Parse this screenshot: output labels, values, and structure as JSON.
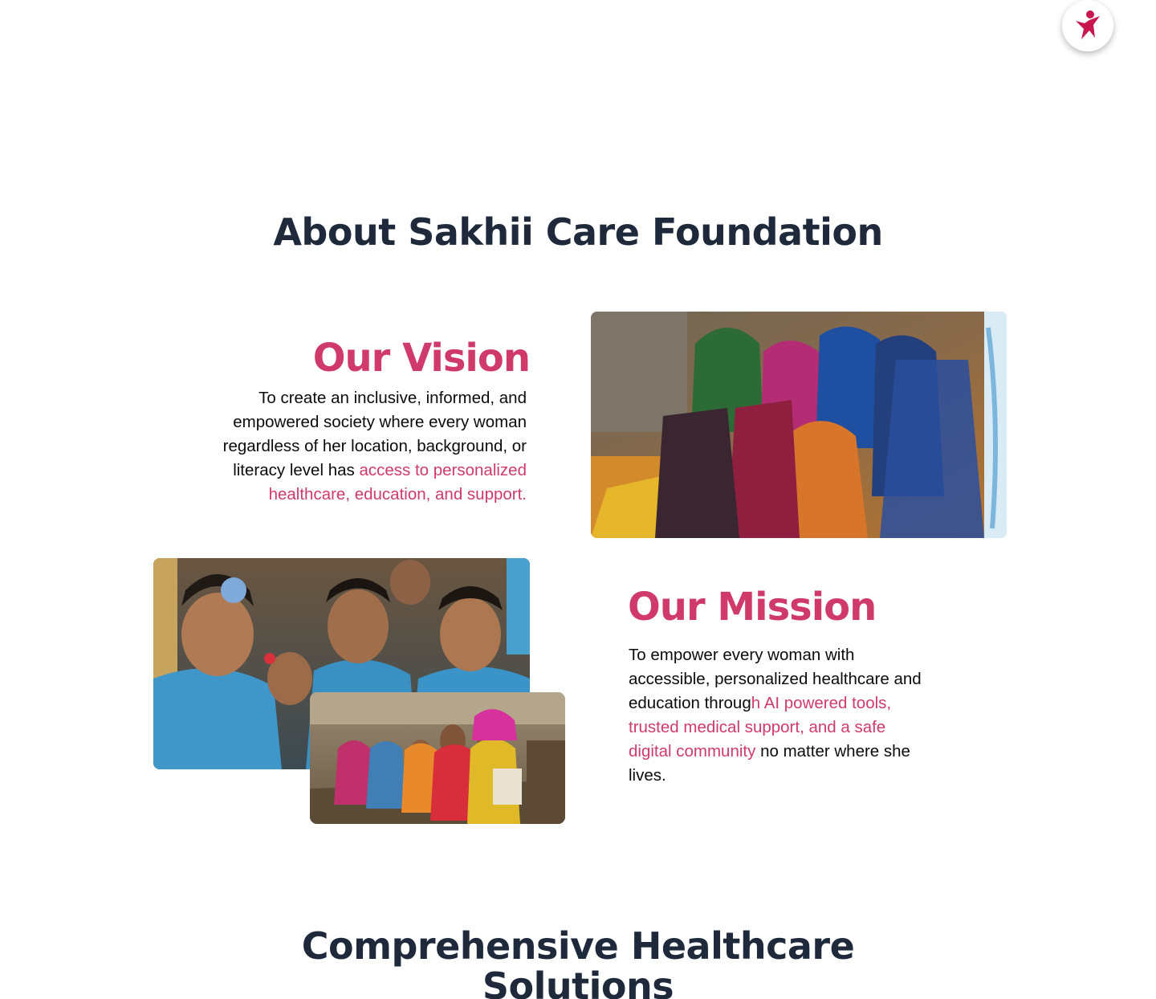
{
  "about": {
    "title": "About Sakhii Care Foundation"
  },
  "vision": {
    "heading": "Our Vision",
    "text": "To create an inclusive, informed, and empowered society where every woman regardless of her location, background, or literacy level has",
    "highlight": "access to personalized healthcare, education, and support."
  },
  "mission": {
    "heading": "Our Mission",
    "text_before": "To empower every woman with accessible, personalized healthcare and education throug",
    "text_h": "h",
    "highlight": "AI powered tools, trusted medical support, and a safe digital community",
    "text_after": "no matter where she lives."
  },
  "solutions": {
    "title_line1": "Comprehensive Healthcare",
    "title_line2": "Solutions"
  },
  "colors": {
    "accent": "#cf3a6a",
    "heading": "#1e2a3b"
  },
  "icons": {
    "fab": "person-star-icon"
  }
}
